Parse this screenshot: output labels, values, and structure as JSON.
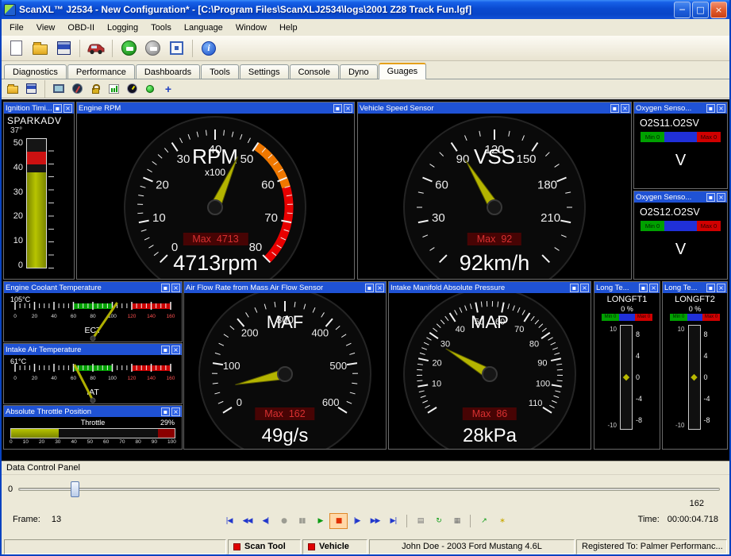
{
  "window": {
    "title": "ScanXL™ J2534 - New Configuration* - [C:\\Program Files\\ScanXLJ2534\\logs\\2001 Z28 Track Fun.lgf]",
    "controls": {
      "minimize": "─",
      "maximize": "□",
      "close": "×"
    }
  },
  "menu": {
    "items": [
      "File",
      "View",
      "OBD-II",
      "Logging",
      "Tools",
      "Language",
      "Window",
      "Help"
    ]
  },
  "tabs": {
    "items": [
      "Diagnostics",
      "Performance",
      "Dashboards",
      "Tools",
      "Settings",
      "Console",
      "Dyno",
      "Guages"
    ],
    "active": "Guages"
  },
  "icons": {
    "info_glyph": "i",
    "add_glyph": "+"
  },
  "panel_buttons": {
    "minimize": "▪",
    "close": "×"
  },
  "gauges": {
    "spark": {
      "type": "vbar",
      "panel_title": "Ignition Timi...",
      "pid": "SPARKADV",
      "value": 37,
      "value_display": "37°",
      "min": 0,
      "max": 50,
      "scale": [
        "50",
        "40",
        "30",
        "20",
        "10",
        "0"
      ],
      "red_zone": [
        40,
        45
      ],
      "fill_color": "#A8B400"
    },
    "rpm": {
      "type": "radial",
      "panel_title": "Engine RPM",
      "title": "RPM",
      "subtitle": "x100",
      "min": 0,
      "max": 80,
      "major": 10,
      "minor": 2,
      "labels": [
        0,
        10,
        20,
        30,
        40,
        50,
        60,
        70,
        80
      ],
      "zones": [
        {
          "from": 50,
          "to": 62,
          "color": "#F07800"
        },
        {
          "from": 62,
          "to": 80,
          "color": "#E80000"
        }
      ],
      "value": 47.13,
      "max_label": "Max  4713",
      "value_display": "4713rpm"
    },
    "vss": {
      "type": "radial",
      "panel_title": "Vehicle Speed Sensor",
      "title": "VSS",
      "subtitle": "",
      "min": 0,
      "max": 240,
      "major": 30,
      "minor": 10,
      "labels": [
        30,
        60,
        90,
        120,
        150,
        180,
        210
      ],
      "zones": [],
      "value": 92,
      "max_label": "Max  92",
      "value_display": "92km/h"
    },
    "o2a": {
      "panel_title": "Oxygen Senso...",
      "pid": "O2S11.O2SV",
      "min_label": "Min 0",
      "max_label": "Max 0",
      "unit": "V"
    },
    "o2b": {
      "panel_title": "Oxygen Senso...",
      "pid": "O2S12.O2SV",
      "min_label": "Min 0",
      "max_label": "Max 0",
      "unit": "V"
    },
    "ect": {
      "type": "temp",
      "panel_title": "Engine Coolant Temperature",
      "pid": "ECT",
      "value": 105,
      "value_display": "105°C",
      "min": 0,
      "max": 160,
      "label_step": 20,
      "minor": 5,
      "green_zone": [
        60,
        100
      ],
      "red_zone": [
        120,
        160
      ]
    },
    "iat": {
      "type": "temp",
      "panel_title": "Intake Air Temperature",
      "pid": "IAT",
      "value": 61,
      "value_display": "61°C",
      "min": 0,
      "max": 160,
      "label_step": 20,
      "minor": 5,
      "green_zone": [
        60,
        100
      ],
      "red_zone": [
        120,
        160
      ]
    },
    "tps": {
      "type": "hbar",
      "panel_title": "Absolute Throttle Position",
      "label": "Throttle",
      "value": 29,
      "value_display": "29%",
      "min": 0,
      "max": 100,
      "scale": [
        "0",
        "10",
        "20",
        "30",
        "40",
        "50",
        "60",
        "70",
        "80",
        "90",
        "100"
      ],
      "red_zone": [
        90,
        100
      ]
    },
    "maf": {
      "type": "radial",
      "panel_title": "Air Flow Rate from Mass Air Flow Sensor",
      "title": "MAF",
      "subtitle": "",
      "min": 0,
      "max": 600,
      "major": 100,
      "minor": 20,
      "labels": [
        0,
        100,
        200,
        300,
        400,
        500,
        600
      ],
      "zones": [],
      "value": 49,
      "max_label": "Max  162",
      "value_display": "49g/s"
    },
    "map": {
      "type": "radial",
      "panel_title": "Intake Manifold Absolute Pressure",
      "title": "MAP",
      "subtitle": "",
      "min": 0,
      "max": 110,
      "major": 10,
      "minor": 2,
      "labels": [
        10,
        20,
        30,
        40,
        50,
        60,
        70,
        80,
        90,
        100,
        110
      ],
      "zones": [],
      "value": 28,
      "max_label": "Max  86",
      "value_display": "28kPa"
    },
    "lft1": {
      "type": "vtrim",
      "panel_title": "Long Te...",
      "pid": "LONGFT1",
      "value": 0,
      "value_display": "0 %",
      "min_label": "Min 0",
      "max_label": "Max 0",
      "left_scale": [
        "10",
        "-10"
      ],
      "right_scale": [
        "8",
        "4",
        "0",
        "-4",
        "-8"
      ],
      "marker": "◆"
    },
    "lft2": {
      "type": "vtrim",
      "panel_title": "Long Te...",
      "pid": "LONGFT2",
      "value": 0,
      "value_display": "0 %",
      "min_label": "Min 0",
      "max_label": "Max 0",
      "left_scale": [
        "10",
        "-10"
      ],
      "right_scale": [
        "8",
        "4",
        "0",
        "-4",
        "-8"
      ],
      "marker": "◆"
    }
  },
  "data_control": {
    "title": "Data Control Panel",
    "slider": {
      "min_label": "0",
      "max_label": "162",
      "value": 13,
      "max": 162
    },
    "frame_label": "Frame:",
    "frame_value": "13",
    "time_label": "Time:",
    "time_value": "00:00:04.718",
    "buttons": [
      {
        "name": "jump-to-start",
        "glyph": "|◀",
        "color": "#2238CC"
      },
      {
        "name": "fast-rewind",
        "glyph": "◀◀",
        "color": "#2238CC"
      },
      {
        "name": "step-back",
        "glyph": "◀|",
        "color": "#2238CC"
      },
      {
        "name": "record",
        "glyph": "●",
        "color": "#9C9C92"
      },
      {
        "name": "pause",
        "glyph": "▮▮",
        "color": "#9C9C92"
      },
      {
        "name": "play",
        "glyph": "▶",
        "color": "#0C9C14"
      },
      {
        "name": "stop",
        "glyph": "■",
        "color": "#E03000",
        "pressed": true
      },
      {
        "name": "step-forward",
        "glyph": "|▶",
        "color": "#2238CC"
      },
      {
        "name": "fast-forward",
        "glyph": "▶▶",
        "color": "#2238CC"
      },
      {
        "name": "jump-to-end",
        "glyph": "▶|",
        "color": "#2238CC"
      },
      {
        "sep": true
      },
      {
        "name": "new-log",
        "glyph": "▤",
        "color": "#707070"
      },
      {
        "name": "loop-playback",
        "glyph": "↻",
        "color": "#0C9C14"
      },
      {
        "name": "save-log",
        "glyph": "▦",
        "color": "#707070"
      },
      {
        "sep": true
      },
      {
        "name": "export-data",
        "glyph": "↗",
        "color": "#0C9C14"
      },
      {
        "name": "live-data",
        "glyph": "∗",
        "color": "#C8A800"
      }
    ]
  },
  "status_bar": {
    "scan_tool": "Scan Tool",
    "vehicle": "Vehicle",
    "user_vehicle": "John Doe - 2003 Ford Mustang 4.6L",
    "registered": "Registered To: Palmer Performanc..."
  }
}
